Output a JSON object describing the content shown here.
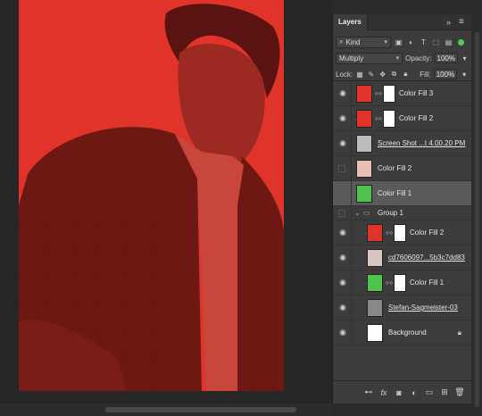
{
  "panel": {
    "tab": "Layers",
    "collapse_icon": "double-chevron-right-icon",
    "menu_icon": "hamburger-menu-icon",
    "filter_kind": "Kind",
    "blend_mode": "Multiply",
    "opacity_label": "Opacity:",
    "opacity_value": "100%",
    "lock_label": "Lock:",
    "fill_label": "Fill:",
    "fill_value": "100%"
  },
  "layers": [
    {
      "name": "Color Fill 3",
      "visible": true,
      "thumb_color": "#e0342b",
      "mask": true,
      "clip": false
    },
    {
      "name": "Color Fill 2",
      "visible": true,
      "thumb_color": "#e0342b",
      "mask": true,
      "clip": true
    },
    {
      "name": "Screen Shot ...t 4.00.20 PM",
      "visible": true,
      "thumb_color": "#bbbbbb",
      "mask": false,
      "clip": false,
      "linked": true
    },
    {
      "name": "Color Fill 2",
      "visible": false,
      "thumb_color": "#e8c0b8",
      "mask": false,
      "clip": false
    },
    {
      "name": "Color Fill 1",
      "visible": false,
      "thumb_color": "#4fc24f",
      "mask": false,
      "clip": false,
      "selected": true
    },
    {
      "name": "Group 1",
      "visible": false,
      "group": true
    },
    {
      "name": "Color Fill 2",
      "visible": true,
      "thumb_color": "#e0342b",
      "mask": true,
      "clip": true
    },
    {
      "name": "cd7606097...5b3c7dd83",
      "visible": true,
      "thumb_color": "#d9c6c0",
      "mask": false,
      "clip": false,
      "linked": true
    },
    {
      "name": "Color Fill 1",
      "visible": true,
      "thumb_color": "#4fc24f",
      "mask": true,
      "clip": true
    },
    {
      "name": "Stefan-Sagmeister-03",
      "visible": true,
      "thumb_color": "#888888",
      "mask": false,
      "clip": false,
      "linked": true
    },
    {
      "name": "Background",
      "visible": true,
      "thumb_color": "#ffffff",
      "mask": false,
      "clip": false,
      "locked": true
    }
  ],
  "footer_icons": [
    "link-layers-icon",
    "fx-icon",
    "add-mask-icon",
    "adjustment-layer-icon",
    "new-group-icon",
    "new-layer-icon",
    "trash-icon"
  ],
  "footer_fx": "fx",
  "colors": {
    "canvas_red": "#e0342b",
    "panel_bg": "#3c3c3c",
    "selected_row": "#5a5a5a"
  }
}
